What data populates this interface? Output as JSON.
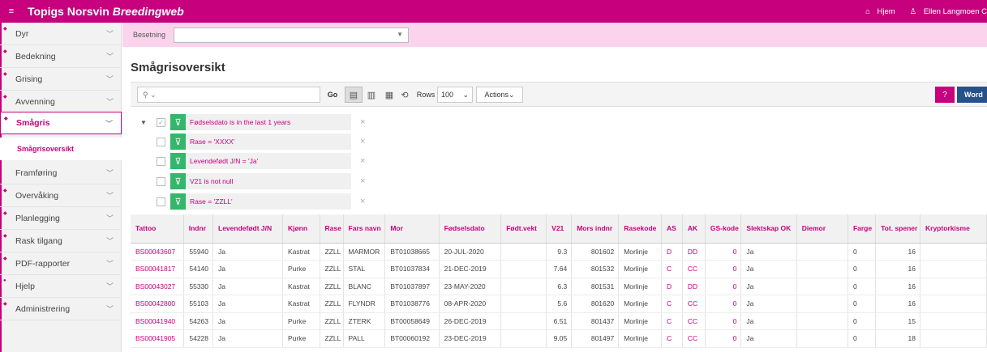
{
  "header": {
    "menu_icon": "≡",
    "title": "Topigs Norsvin",
    "title_italic": "Breedingweb",
    "home_label": "Hjem",
    "user_name": "Ellen Langmoen C"
  },
  "sidebar": {
    "items": [
      {
        "label": "Dyr"
      },
      {
        "label": "Bedekning"
      },
      {
        "label": "Grising"
      },
      {
        "label": "Avvenning"
      },
      {
        "label": "Smågris"
      },
      {
        "label": "Smågrisoversikt"
      },
      {
        "label": "Framføring"
      },
      {
        "label": "Overvåking"
      },
      {
        "label": "Planlegging"
      },
      {
        "label": "Rask tilgang"
      },
      {
        "label": "PDF-rapporter"
      },
      {
        "label": "Hjelp"
      },
      {
        "label": "Administrering"
      }
    ]
  },
  "besetning": {
    "label": "Besetning",
    "value": ""
  },
  "page": {
    "title": "Smågrisoversikt"
  },
  "toolbar": {
    "search_placeholder": "",
    "go_label": "Go",
    "rows_label": "Rows",
    "rows_value": "100",
    "actions_label": "Actions",
    "word_label": "Word"
  },
  "filters": [
    {
      "text": "Fødselsdato is in the last 1 years",
      "checked": true
    },
    {
      "text": "Rase = 'XXXX'",
      "checked": false
    },
    {
      "text": "Levendefødt J/N = 'Ja'",
      "checked": false
    },
    {
      "text": "V21 is not null",
      "checked": false
    },
    {
      "text": "Rase = 'ZZLL'",
      "checked": false
    }
  ],
  "table": {
    "columns": [
      "Tattoo",
      "Indnr",
      "Levendefødt J/N",
      "Kjønn",
      "Rase",
      "Fars navn",
      "Mor",
      "Fødselsdato",
      "Født.vekt",
      "V21",
      "Mors indnr",
      "Rasekode",
      "AS",
      "AK",
      "GS-kode",
      "Slektskap OK",
      "Diemor",
      "Farge",
      "Tot. spener",
      "Kryptorkisme"
    ],
    "rows": [
      [
        "BS00043607",
        "55940",
        "Ja",
        "Kastrat",
        "ZZLL",
        "MARMOR",
        "BT01038665",
        "20-JUL-2020",
        "",
        "9.3",
        "801602",
        "Morlinje",
        "D",
        "DD",
        "0",
        "Ja",
        "",
        "0",
        "16",
        ""
      ],
      [
        "BS00041817",
        "54140",
        "Ja",
        "Purke",
        "ZZLL",
        "STAL",
        "BT01037834",
        "21-DEC-2019",
        "",
        "7.64",
        "801532",
        "Morlinje",
        "C",
        "CC",
        "0",
        "Ja",
        "",
        "0",
        "16",
        ""
      ],
      [
        "BS00043027",
        "55330",
        "Ja",
        "Kastrat",
        "ZZLL",
        "BLANC",
        "BT01037897",
        "23-MAY-2020",
        "",
        "6.3",
        "801531",
        "Morlinje",
        "D",
        "DD",
        "0",
        "Ja",
        "",
        "0",
        "16",
        ""
      ],
      [
        "BS00042800",
        "55103",
        "Ja",
        "Kastrat",
        "ZZLL",
        "FLYNDR",
        "BT01038776",
        "08-APR-2020",
        "",
        "5.6",
        "801620",
        "Morlinje",
        "C",
        "CC",
        "0",
        "Ja",
        "",
        "0",
        "16",
        ""
      ],
      [
        "BS00041940",
        "54263",
        "Ja",
        "Purke",
        "ZZLL",
        "ZTERK",
        "BT00058649",
        "26-DEC-2019",
        "",
        "6.51",
        "801437",
        "Morlinje",
        "C",
        "CC",
        "0",
        "Ja",
        "",
        "0",
        "15",
        ""
      ],
      [
        "BS00041905",
        "54228",
        "Ja",
        "Purke",
        "ZZLL",
        "PALL",
        "BT00060192",
        "23-DEC-2019",
        "",
        "9.05",
        "801497",
        "Morlinje",
        "C",
        "CC",
        "0",
        "Ja",
        "",
        "0",
        "18",
        ""
      ]
    ]
  }
}
